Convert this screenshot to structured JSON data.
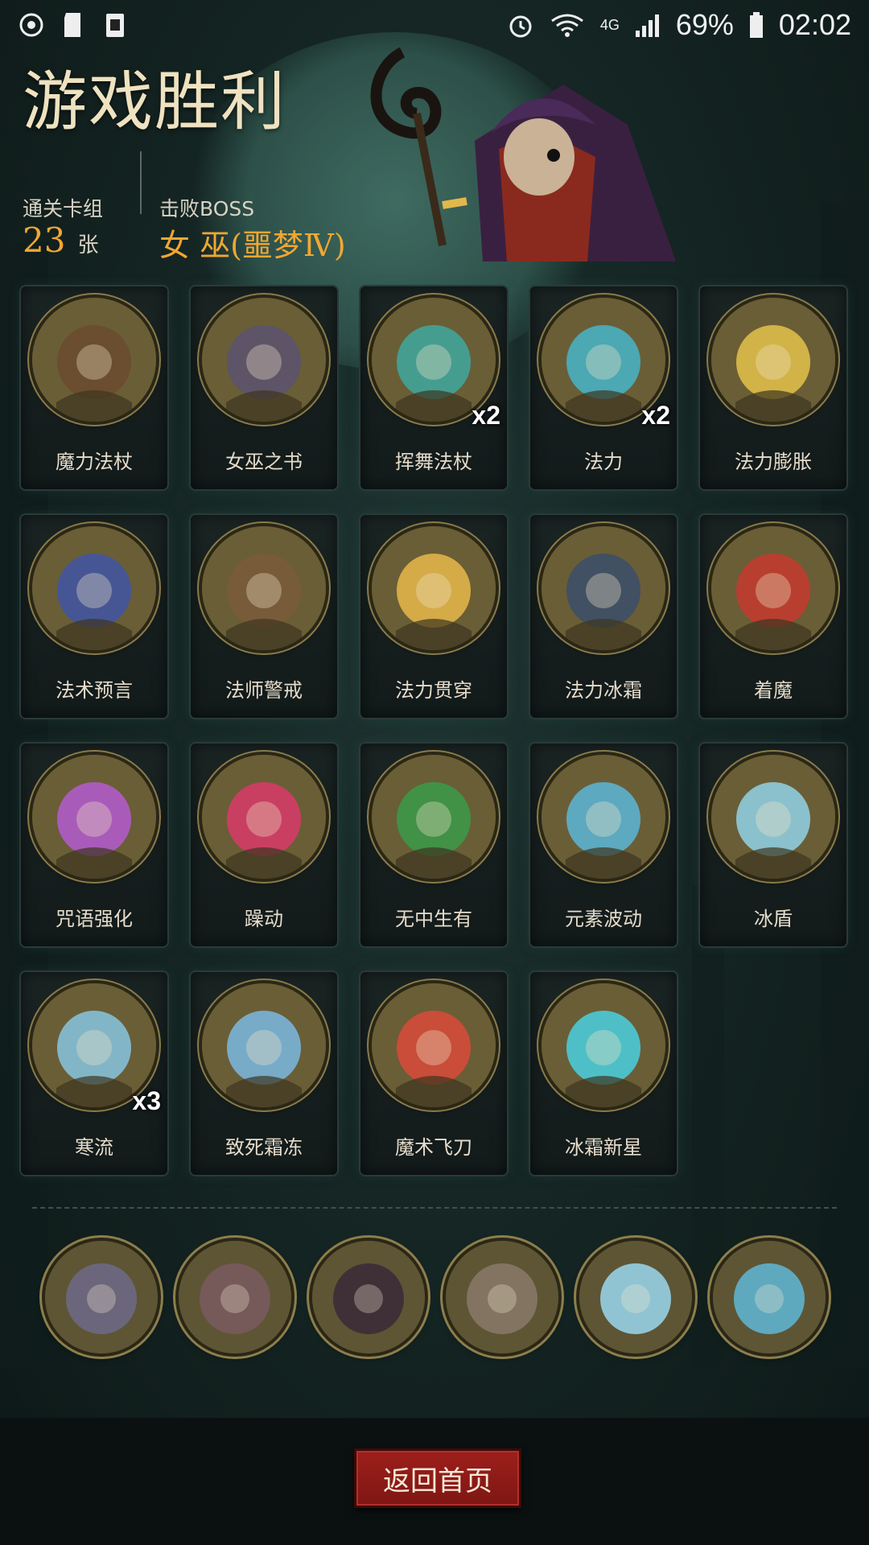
{
  "status_bar": {
    "left_icons": [
      "power-saving-icon",
      "sd-card-icon",
      "app-notification-icon"
    ],
    "right_icons": [
      "alarm-icon",
      "wifi-icon",
      "signal-icon",
      "battery-icon"
    ],
    "network": "4G",
    "battery": "69%",
    "time": "02:02"
  },
  "header": {
    "title": "游戏胜利",
    "deck_label": "通关卡组",
    "deck_count": "23",
    "deck_unit": "张",
    "boss_label": "击败BOSS",
    "boss_name": "女 巫(噩梦Ⅳ)"
  },
  "cards": [
    {
      "name": "魔力法杖",
      "count": "",
      "icon": "staff-icon",
      "color": "#6b4a2e"
    },
    {
      "name": "女巫之书",
      "count": "",
      "icon": "skull-book-icon",
      "color": "#5a5270"
    },
    {
      "name": "挥舞法杖",
      "count": "x2",
      "icon": "witch-swing-icon",
      "color": "#3ea8a0"
    },
    {
      "name": "法力",
      "count": "x2",
      "icon": "mana-orb-icon",
      "color": "#46b5c9"
    },
    {
      "name": "法力膨胀",
      "count": "",
      "icon": "lightning-figure-icon",
      "color": "#e3c24a"
    },
    {
      "name": "法术预言",
      "count": "",
      "icon": "crystal-ball-icon",
      "color": "#3f55a6"
    },
    {
      "name": "法师警戒",
      "count": "",
      "icon": "hooded-mage-icon",
      "color": "#7a5a3a"
    },
    {
      "name": "法力贯穿",
      "count": "",
      "icon": "shield-pierce-icon",
      "color": "#e6b84a"
    },
    {
      "name": "法力冰霜",
      "count": "",
      "icon": "frost-hands-icon",
      "color": "#3a4d6a"
    },
    {
      "name": "着魔",
      "count": "",
      "icon": "possessed-man-icon",
      "color": "#c63a2e"
    },
    {
      "name": "咒语强化",
      "count": "",
      "icon": "rune-crystals-icon",
      "color": "#b45ad0"
    },
    {
      "name": "躁动",
      "count": "",
      "icon": "frenzy-icon",
      "color": "#d93a6a"
    },
    {
      "name": "无中生有",
      "count": "",
      "icon": "summon-box-icon",
      "color": "#3a9a4a"
    },
    {
      "name": "元素波动",
      "count": "",
      "icon": "element-wave-icon",
      "color": "#5ab6d8"
    },
    {
      "name": "冰盾",
      "count": "",
      "icon": "ice-shield-wizard-icon",
      "color": "#8fd2e6"
    },
    {
      "name": "寒流",
      "count": "x3",
      "icon": "cold-wind-tree-icon",
      "color": "#86c6e0"
    },
    {
      "name": "致死霜冻",
      "count": "",
      "icon": "frozen-skeleton-icon",
      "color": "#7ab8e2"
    },
    {
      "name": "魔术飞刀",
      "count": "",
      "icon": "clown-juggler-icon",
      "color": "#d94a3a"
    },
    {
      "name": "冰霜新星",
      "count": "",
      "icon": "frost-nova-icon",
      "color": "#4ad0e0"
    }
  ],
  "relics": [
    {
      "icon": "card-deck-relic-icon",
      "color": "#6f6a8a"
    },
    {
      "icon": "hand-cards-relic-icon",
      "color": "#7a5a60"
    },
    {
      "icon": "red-book-relic-icon",
      "color": "#3a2a3a"
    },
    {
      "icon": "old-man-relic-icon",
      "color": "#8a7a6a"
    },
    {
      "icon": "crossed-staffs-relic-icon",
      "color": "#9ad8ee"
    },
    {
      "icon": "ice-golem-relic-icon",
      "color": "#5fb8d8"
    }
  ],
  "buttons": {
    "home": "返回首页"
  }
}
